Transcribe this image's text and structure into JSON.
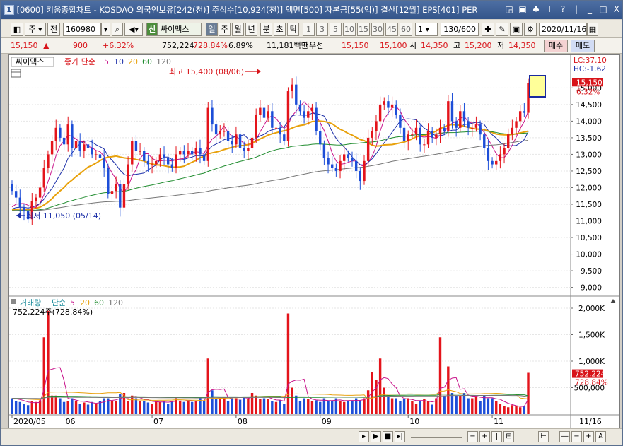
{
  "window": {
    "title": "[0600] 키움종합차트 - KOSDAQ 외국인보유[242(천)] 주식수[10,924(천)] 액면[500] 자본금[55(억)] 결산[12월] EPS[401] PER",
    "badge": "1",
    "buttons": [
      "◲",
      "▣",
      "♣",
      "T",
      "?",
      "|",
      "_",
      "□",
      "X"
    ]
  },
  "toolbar": {
    "market": "주",
    "prev_label": "전",
    "code": "160980",
    "badge_new": "신",
    "stock_name": "싸이맥스",
    "periods": [
      "일",
      "주",
      "월",
      "년",
      "분",
      "초",
      "틱"
    ],
    "active_period": "일",
    "minutes": [
      "1",
      "3",
      "5",
      "10",
      "15",
      "30",
      "45",
      "60"
    ],
    "unit_value": "1",
    "count": "130/600",
    "date": "2020/11/16"
  },
  "quote": {
    "price": "15,150",
    "change_arrow": "▲",
    "change": "900",
    "change_pct": "+6.32%",
    "volume": "752,224",
    "volume_ratio": "728.84%",
    "turnover": "6.89%",
    "value": "11,181백만",
    "best_label": "최우선",
    "ask": "15,150",
    "bid": "15,100",
    "open_label": "시",
    "open": "14,350",
    "high_label": "고",
    "high": "15,200",
    "low_label": "저",
    "low": "14,350",
    "buy_label": "매수",
    "sell_label": "매도"
  },
  "price_panel": {
    "legend_name": "싸이맥스",
    "legend_label": "종가 단순",
    "ma_periods": [
      "5",
      "10",
      "20",
      "60",
      "120"
    ],
    "ma_colors": [
      "#c8128a",
      "#1c2fa8",
      "#e8a10b",
      "#1f8c2e",
      "#777777"
    ],
    "label_high": "최고 15,400 (08/06)",
    "label_low": "최저 11,050 (05/14)",
    "lc": "LC:37.10",
    "hc": "HC:-1.62",
    "last_price": "15,150",
    "last_pct": "6.32%"
  },
  "volume_panel": {
    "legend_label": "거래량",
    "legend_sub": "단순",
    "ma_periods": [
      "5",
      "20",
      "60",
      "120"
    ],
    "ma_colors": [
      "#c8128a",
      "#e8a10b",
      "#1f8c2e",
      "#777777"
    ],
    "current": "752,224주(728.84%)",
    "last_volume": "752,224",
    "last_pct": "728.84%"
  },
  "x_axis": {
    "labels": [
      "2020/05",
      "06",
      "07",
      "08",
      "09",
      "10",
      "11"
    ],
    "end_label": "11/16"
  },
  "chart_data": {
    "type": "candlestick",
    "y_ticks": [
      "9,000",
      "9,500",
      "10,000",
      "10,500",
      "11,000",
      "11,500",
      "12,000",
      "12,500",
      "13,000",
      "13,500",
      "14,000",
      "14,500",
      "15,000"
    ],
    "vol_ticks": [
      "2,000K",
      "1,500K",
      "1,000K",
      "500,000"
    ],
    "ylim": [
      8800,
      15900
    ],
    "vol_lim": [
      0,
      2200000
    ],
    "close": [
      11900,
      11700,
      11400,
      11300,
      11050,
      11600,
      11700,
      12000,
      12600,
      13000,
      13400,
      13800,
      13500,
      13300,
      13900,
      13200,
      13400,
      13100,
      13300,
      13200,
      13000,
      13000,
      12900,
      12600,
      11800,
      11900,
      12100,
      11400,
      12100,
      12700,
      13400,
      13100,
      13100,
      12800,
      12700,
      12700,
      12800,
      13000,
      12900,
      12700,
      12600,
      13000,
      13100,
      13000,
      13100,
      13000,
      13200,
      13000,
      12800,
      14400,
      13900,
      13600,
      13700,
      13700,
      13400,
      13300,
      13600,
      13200,
      13100,
      13200,
      13500,
      14200,
      14400,
      14100,
      14300,
      13800,
      13800,
      13600,
      13400,
      14900,
      15100,
      14500,
      14300,
      14100,
      14300,
      14400,
      13700,
      13300,
      12900,
      12700,
      12600,
      12500,
      12800,
      13000,
      12900,
      12800,
      12500,
      12200,
      12800,
      13500,
      13700,
      14000,
      14500,
      14600,
      14400,
      14500,
      14200,
      13800,
      13400,
      13600,
      13600,
      13800,
      13300,
      13300,
      13700,
      13500,
      13600,
      13800,
      13700,
      14600,
      14000,
      13800,
      14300,
      14000,
      13800,
      13800,
      13900,
      13600,
      13200,
      12800,
      12700,
      12800,
      13000,
      13200,
      13600,
      13800,
      14000,
      14300,
      14250,
      15150
    ],
    "volume": [
      300000,
      250000,
      230000,
      200000,
      170000,
      250000,
      230000,
      260000,
      1450000,
      1950000,
      350000,
      350000,
      300000,
      230000,
      250000,
      300000,
      250000,
      200000,
      220000,
      180000,
      230000,
      200000,
      250000,
      300000,
      300000,
      250000,
      250000,
      380000,
      400000,
      250000,
      350000,
      300000,
      250000,
      250000,
      220000,
      200000,
      250000,
      230000,
      250000,
      200000,
      250000,
      300000,
      250000,
      230000,
      250000,
      230000,
      250000,
      300000,
      250000,
      1050000,
      450000,
      300000,
      280000,
      300000,
      250000,
      300000,
      300000,
      270000,
      320000,
      300000,
      400000,
      350000,
      280000,
      300000,
      280000,
      250000,
      230000,
      270000,
      200000,
      1900000,
      500000,
      350000,
      250000,
      300000,
      280000,
      250000,
      260000,
      230000,
      300000,
      250000,
      240000,
      300000,
      250000,
      230000,
      260000,
      250000,
      300000,
      260000,
      300000,
      450000,
      800000,
      650000,
      1050000,
      500000,
      350000,
      300000,
      300000,
      250000,
      280000,
      300000,
      250000,
      200000,
      250000,
      280000,
      250000,
      180000,
      300000,
      1450000,
      350000,
      900000,
      400000,
      350000,
      350000,
      400000,
      300000,
      300000,
      350000,
      250000,
      350000,
      300000,
      300000,
      250000,
      200000,
      150000,
      130000,
      170000,
      150000,
      130000,
      160000,
      780000
    ]
  }
}
